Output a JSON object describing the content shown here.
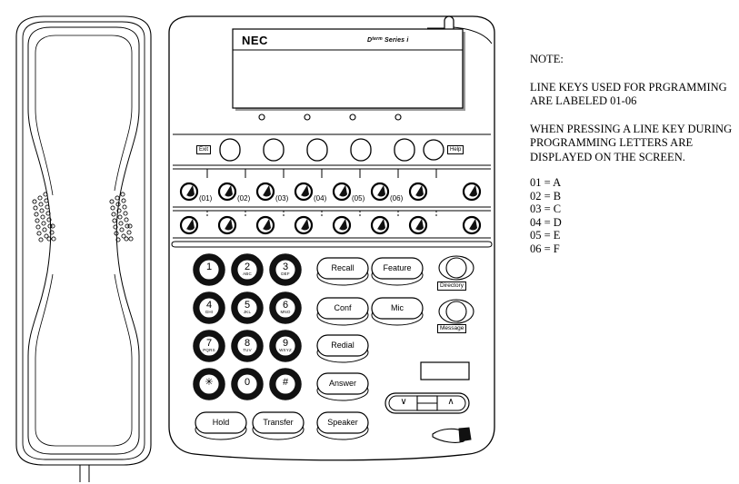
{
  "document": {
    "title": "NEC Dterm Series i Telephone Programming Diagram",
    "type": "line-art-diagram"
  },
  "phone": {
    "display": {
      "brand": "NEC",
      "model_prefix": "D",
      "model_sup": "term",
      "model_suffix": " Series i",
      "lcd_lines": [
        "",
        "",
        "",
        ""
      ],
      "indicator_count": 4
    },
    "status_lamp": {
      "name": "call-indicator-lamp"
    },
    "softkey_row": {
      "left_tag": "Exit",
      "right_tag": "Help",
      "key_count": 6
    },
    "line_keys": {
      "row1_labels": [
        "(01)",
        "(02)",
        "(03)",
        "(04)",
        "(05)",
        "(06)",
        "",
        ""
      ],
      "row2_labels": [
        "",
        "",
        "",
        "",
        "",
        "",
        "",
        ""
      ],
      "keys_per_row": 8
    },
    "dialpad": [
      {
        "digit": "1",
        "letters": ""
      },
      {
        "digit": "2",
        "letters": "ABC"
      },
      {
        "digit": "3",
        "letters": "DEF"
      },
      {
        "digit": "4",
        "letters": "GHI"
      },
      {
        "digit": "5",
        "letters": "JKL"
      },
      {
        "digit": "6",
        "letters": "MNO"
      },
      {
        "digit": "7",
        "letters": "PQRS"
      },
      {
        "digit": "8",
        "letters": "TUV"
      },
      {
        "digit": "9",
        "letters": "WXYZ"
      },
      {
        "digit": "✳",
        "letters": ""
      },
      {
        "digit": "0",
        "letters": ""
      },
      {
        "digit": "#",
        "letters": ""
      }
    ],
    "function_keys_col1": [
      "Recall",
      "Conf",
      "Redial",
      "Answer"
    ],
    "function_keys_col2": [
      "Feature",
      "Mic"
    ],
    "bottom_keys": [
      "Hold",
      "Transfer",
      "Speaker"
    ],
    "feature_buttons": [
      {
        "label": "Directory"
      },
      {
        "label": "Message"
      }
    ],
    "volume_rocker": {
      "down_glyph": "∨",
      "up_glyph": "∧"
    },
    "blank_label_strip": "",
    "microphone": {
      "name": "microphone"
    },
    "handset": {
      "name": "handset-receiver"
    }
  },
  "note": {
    "heading": "NOTE:",
    "paragraph1": [
      "LINE KEYS USED FOR PRGRAMMING",
      "ARE LABELED 01-06"
    ],
    "paragraph2": [
      "WHEN PRESSING A LINE KEY DURING",
      "PROGRAMMING LETTERS ARE",
      "DISPLAYED ON THE SCREEN."
    ],
    "mapping": [
      "01 = A",
      "02 = B",
      "03 = C",
      "04 = D",
      "05 = E",
      "06 = F"
    ]
  },
  "colors": {
    "stroke": "#000000",
    "background": "#ffffff",
    "key_ring": "#1a1a1a"
  }
}
